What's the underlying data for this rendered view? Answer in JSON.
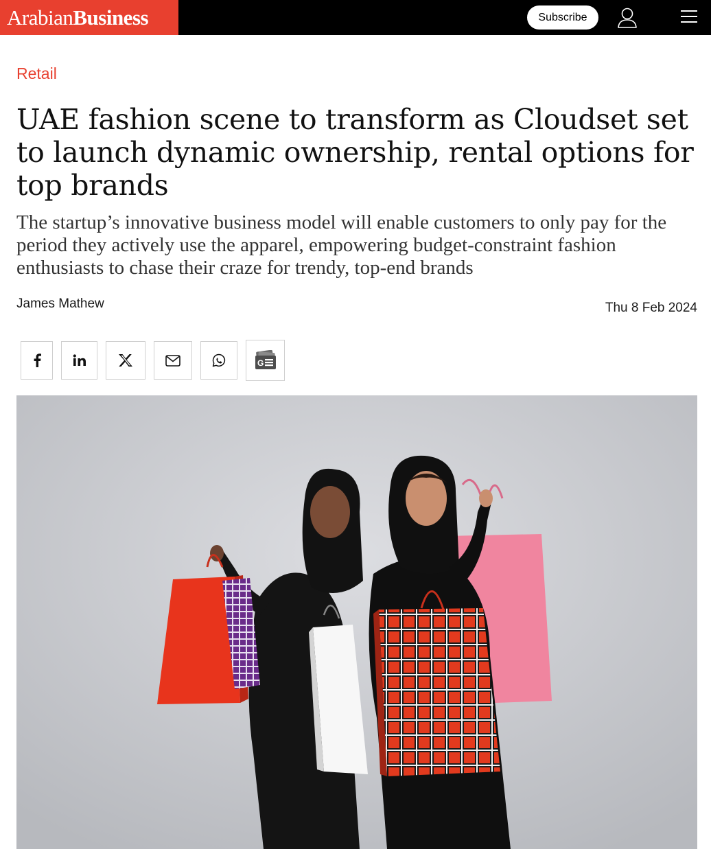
{
  "header": {
    "logo_part1": "Arabian",
    "logo_part2": "Business",
    "subscribe_label": "Subscribe",
    "user_icon": "user-icon",
    "menu_icon": "hamburger-menu-icon",
    "brand_color": "#e8402f",
    "bar_color": "#000000"
  },
  "article": {
    "category": "Retail",
    "headline": "UAE fashion scene to transform as Cloudset set to launch dynamic ownership, rental options for top brands",
    "standfirst": "The startup’s innovative business model will enable customers to only pay for the period they actively use the apparel, empowering budget-constraint fashion enthusiasts to chase their craze for trendy, top-end brands",
    "author": "James Mathew",
    "date": "Thu 8 Feb 2024"
  },
  "share": {
    "buttons": [
      {
        "icon": "facebook-icon"
      },
      {
        "icon": "linkedin-icon"
      },
      {
        "icon": "x-twitter-icon"
      },
      {
        "icon": "email-icon"
      },
      {
        "icon": "whatsapp-icon"
      },
      {
        "icon": "google-news-icon"
      }
    ]
  },
  "hero_image": {
    "subject": "two women in abayas holding shopping bags"
  }
}
